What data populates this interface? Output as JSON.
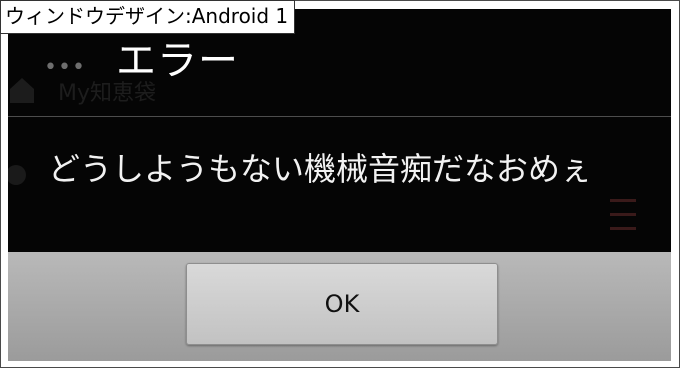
{
  "caption": "ウィンドウデザイン:Android 1",
  "dialog": {
    "title": "エラー",
    "message": "どうしようもない機械音痴だなおめぇ",
    "ok_label": "OK"
  },
  "background_app": {
    "menu_dots": "•••",
    "item_text": "My知恵袋"
  },
  "colors": {
    "dialog_bg": "#050505",
    "button_bar": "#b0b0b0",
    "button": "#cfcfcf",
    "text": "#ffffff"
  }
}
